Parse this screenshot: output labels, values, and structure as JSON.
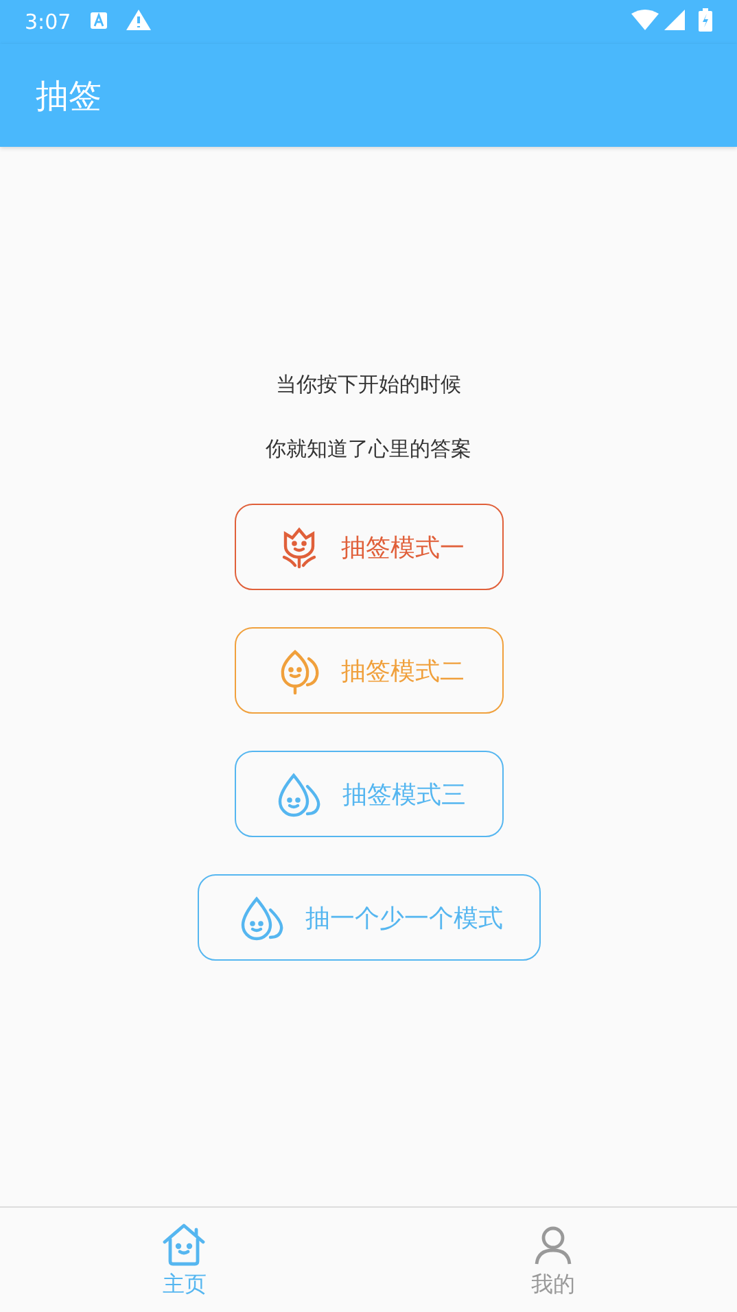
{
  "status_bar": {
    "time": "3:07"
  },
  "app_bar": {
    "title": "抽签"
  },
  "intro": [
    "当你按下开始的时候",
    "你就知道了心里的答案"
  ],
  "modes": [
    {
      "label": "抽签模式一",
      "kind": "flower",
      "color": "#e0603a"
    },
    {
      "label": "抽签模式二",
      "kind": "leaf",
      "color": "#f0a03c"
    },
    {
      "label": "抽签模式三",
      "kind": "drops",
      "color": "#55b6f0"
    },
    {
      "label": "抽一个少一个模式",
      "kind": "drops",
      "color": "#55b6f0"
    }
  ],
  "tabs": [
    {
      "label": "主页",
      "kind": "home",
      "selected": true
    },
    {
      "label": "我的",
      "kind": "person",
      "selected": false
    }
  ]
}
